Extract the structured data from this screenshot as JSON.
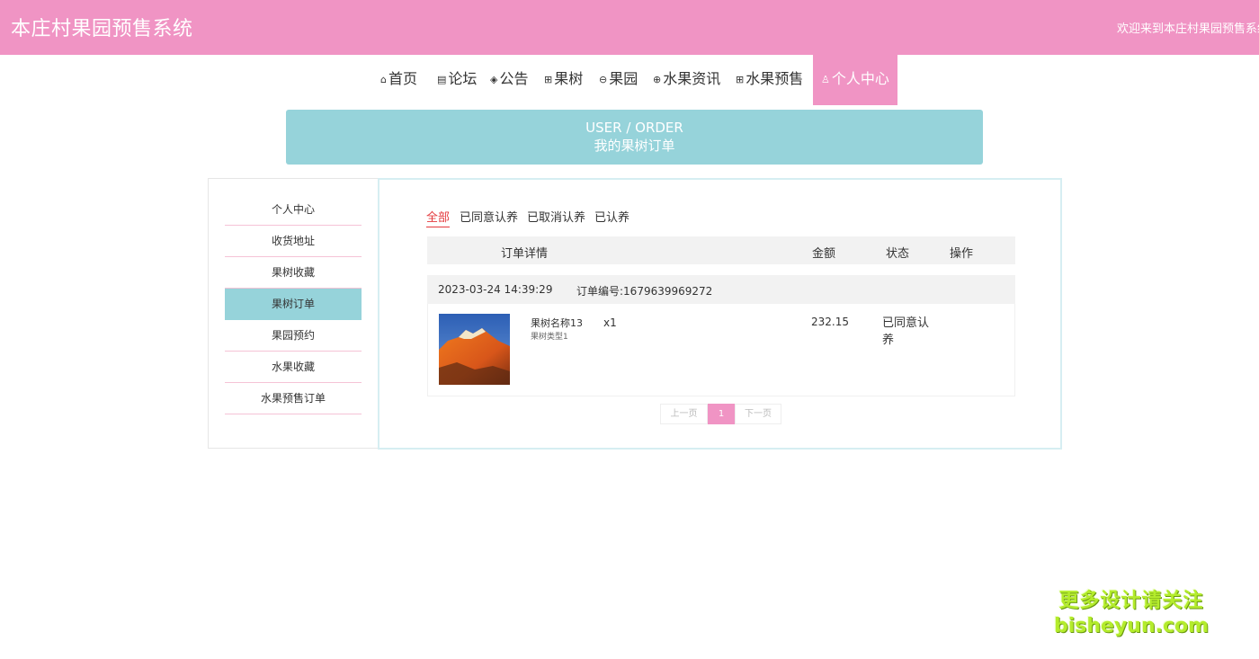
{
  "header": {
    "title": "本庄村果园预售系统",
    "welcome": "欢迎来到本庄村果园预售系统"
  },
  "nav": [
    {
      "label": "首页",
      "icon": "⌂"
    },
    {
      "label": "论坛",
      "icon": "▤"
    },
    {
      "label": "公告",
      "icon": "◈"
    },
    {
      "label": "果树",
      "icon": "⊞"
    },
    {
      "label": "果园",
      "icon": "⊖"
    },
    {
      "label": "水果资讯",
      "icon": "⊕"
    },
    {
      "label": "水果预售",
      "icon": "⊞"
    },
    {
      "label": "个人中心",
      "icon": "♙",
      "active": true
    }
  ],
  "banner": {
    "title_en": "USER / ORDER",
    "title_cn": "我的果树订单"
  },
  "sidebar": {
    "items": [
      {
        "label": "个人中心"
      },
      {
        "label": "收货地址"
      },
      {
        "label": "果树收藏"
      },
      {
        "label": "果树订单",
        "active": true
      },
      {
        "label": "果园预约"
      },
      {
        "label": "水果收藏"
      },
      {
        "label": "水果预售订单"
      }
    ]
  },
  "tabs": [
    "全部",
    "已同意认养",
    "已取消认养",
    "已认养"
  ],
  "table": {
    "headers": {
      "detail": "订单详情",
      "amount": "金额",
      "status": "状态",
      "action": "操作"
    }
  },
  "orders": [
    {
      "time": "2023-03-24 14:39:29",
      "number": "订单编号:1679639969272",
      "name": "果树名称13",
      "type": "果树类型1",
      "qty": "x1",
      "amount": "232.15",
      "status": "已同意认养"
    }
  ],
  "pager": {
    "prev": "上一页",
    "current": "1",
    "next": "下一页"
  },
  "watermark": {
    "line1": "更多设计请关注",
    "line2": "bisheyun.com"
  },
  "colors": {
    "brand_pink": "#f094c4",
    "accent_teal": "#96d3da",
    "active_red": "#e4393c"
  }
}
